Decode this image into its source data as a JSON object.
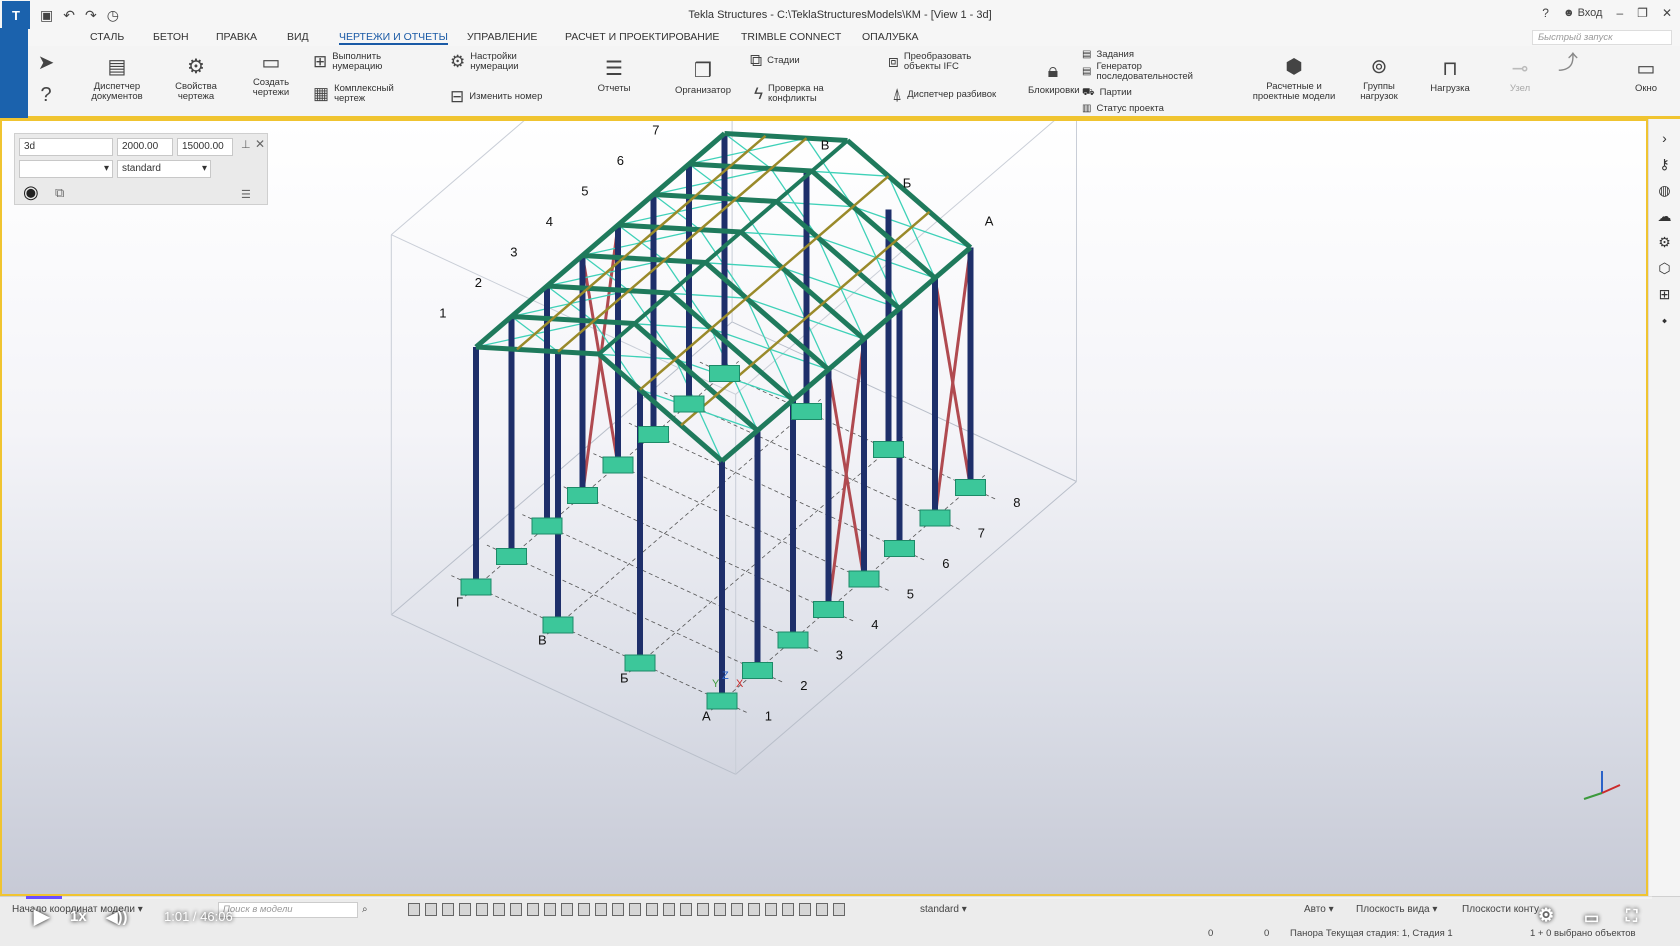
{
  "titlebar": {
    "title": "Tekla Structures - C:\\TeklaStructuresModels\\КМ  - [View 1 - 3d]",
    "user": "Вход",
    "help": "?",
    "quick_access": [
      "save-icon",
      "undo-icon",
      "redo-icon",
      "history-icon"
    ]
  },
  "tabs": [
    "СТАЛЬ",
    "БЕТОН",
    "ПРАВКА",
    "ВИД",
    "ЧЕРТЕЖИ И ОТЧЕТЫ",
    "УПРАВЛЕНИЕ",
    "РАСЧЕТ И ПРОЕКТИРОВАНИЕ",
    "TRIMBLE CONNECT",
    "ОПАЛУБКА"
  ],
  "active_tab": "ЧЕРТЕЖИ И ОТЧЕТЫ",
  "quick_search": "Быстрый запуск",
  "ribbon": {
    "doc_manager": "Диспетчер документов",
    "drawing_props": "Свойства чертежа",
    "create_drawings": "Создать чертежи",
    "do_numbering": "Выполнить нумерацию",
    "complex_drawing": "Комплексный чертеж",
    "numbering_settings": "Настройки нумерации",
    "change_number": "Изменить номер",
    "reports": "Отчеты",
    "organizer": "Организатор",
    "phases": "Стадии",
    "clash_check": "Проверка на конфликты",
    "convert_ifc": "Преобразовать объекты IFC",
    "layout_manager": "Диспетчер разбивок",
    "locks": "Блокировки",
    "tasks": "Задания",
    "sequence_gen": "Генератор последовательностей",
    "lots": "Партии",
    "project_status": "Статус проекта",
    "analysis_models": "Расчетные и проектные модели",
    "load_groups": "Группы нагрузок",
    "load": "Нагрузка",
    "nodes": "Узел",
    "window": "Окно"
  },
  "view_panel": {
    "name": "3d",
    "depth_up": "2000.00",
    "depth_down": "15000.00",
    "filter": "",
    "representation": "standard"
  },
  "model": {
    "axis_letters": [
      "А",
      "Б",
      "В",
      "Г"
    ],
    "axis_numbers": [
      "1",
      "2",
      "3",
      "4",
      "5",
      "6",
      "7",
      "8"
    ],
    "coord_labels": [
      "Y",
      "Z",
      "X"
    ]
  },
  "statusbar": {
    "origin": "Начало координат модели",
    "search": "Поиск в модели",
    "representation": "standard",
    "auto": "Авто",
    "view_plane": "Плоскость вида",
    "contour_plane": "Плоскости конту",
    "x_count": "0",
    "y_count": "0",
    "pan_status": "Панора Текущая стадия: 1, Стадия 1",
    "selected": "1 + 0 выбрано объектов"
  },
  "player": {
    "speed": "1x",
    "time": "1:01 / 46:06",
    "progress": 0.022
  },
  "colors": {
    "accent": "#1b62ad",
    "column": "#1e2f6a",
    "rafter": "#1f7a5c",
    "purlin": "#9a8a2a",
    "brace": "#3fd1b8",
    "wall_brace": "#b04a50",
    "footing": "#3cc79a",
    "viewport_border": "#f0c430"
  }
}
